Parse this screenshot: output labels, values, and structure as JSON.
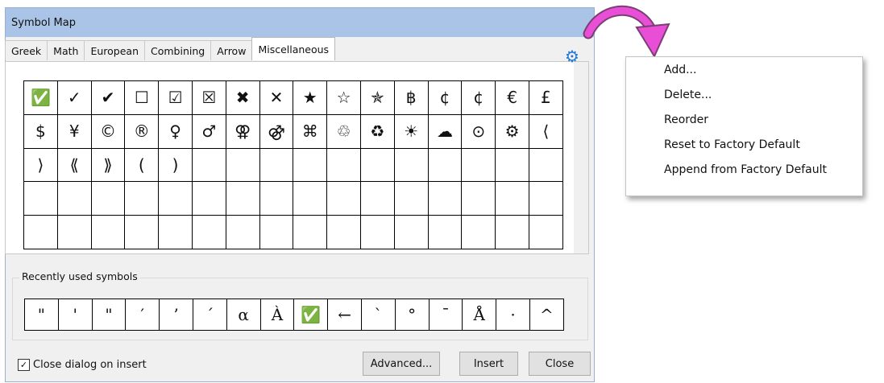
{
  "window": {
    "title": "Symbol Map"
  },
  "tabs": [
    {
      "label": "Greek",
      "active": false
    },
    {
      "label": "Math",
      "active": false
    },
    {
      "label": "European",
      "active": false
    },
    {
      "label": "Combining",
      "active": false
    },
    {
      "label": "Arrow",
      "active": false
    },
    {
      "label": "Miscellaneous",
      "active": true
    }
  ],
  "settings_icon": "gear-icon",
  "symbols": [
    [
      "✅",
      "✓",
      "✔",
      "☐",
      "☑",
      "☒",
      "✖",
      "✕",
      "★",
      "☆",
      "✯",
      "฿",
      "¢",
      "¢",
      "€",
      "£"
    ],
    [
      "$",
      "¥",
      "©",
      "®",
      "♀",
      "♂",
      "⚢",
      "⚣",
      "⌘",
      "♲",
      "♻",
      "☀",
      "☁",
      "⊙",
      "⚙",
      "⟨"
    ],
    [
      "⟩",
      "⟪",
      "⟫",
      "(",
      ")",
      "",
      "",
      "",
      "",
      "",
      "",
      "",
      "",
      "",
      "",
      ""
    ],
    [
      "",
      "",
      "",
      "",
      "",
      "",
      "",
      "",
      "",
      "",
      "",
      "",
      "",
      "",
      "",
      ""
    ],
    [
      "",
      "",
      "",
      "",
      "",
      "",
      "",
      "",
      "",
      "",
      "",
      "",
      "",
      "",
      "",
      ""
    ]
  ],
  "recent": {
    "label": "Recently used symbols",
    "symbols": [
      "\"",
      "'",
      "\"",
      "′",
      "’",
      "´",
      "α",
      "À",
      "✅",
      "←",
      "`",
      "°",
      "¯",
      "Å",
      "·",
      "^"
    ]
  },
  "close_on_insert": {
    "label": "Close dialog on insert",
    "checked": true
  },
  "buttons": {
    "advanced": "Advanced...",
    "insert": "Insert",
    "close": "Close"
  },
  "context_menu": [
    "Add...",
    "Delete...",
    "Reorder",
    "Reset to Factory Default",
    "Append from Factory Default"
  ],
  "colors": {
    "titlebar": "#a9c4e6",
    "gear": "#1f78d6",
    "callout_arrow": "#e84fd6"
  }
}
